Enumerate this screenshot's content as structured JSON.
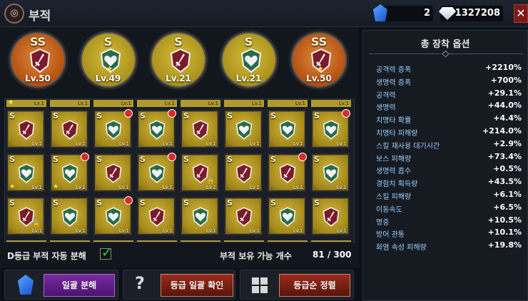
{
  "header": {
    "title": "부적",
    "gem_count": "2",
    "diamond_count": "1327208",
    "close_label": "✕"
  },
  "equipped": [
    {
      "grade": "SS",
      "level": "Lv.50",
      "type": "sword",
      "color": "orange",
      "star": false
    },
    {
      "grade": "S",
      "level": "Lv.49",
      "type": "heart",
      "color": "gold",
      "star": true
    },
    {
      "grade": "S",
      "level": "Lv.21",
      "type": "sword",
      "color": "gold",
      "star": false
    },
    {
      "grade": "S",
      "level": "Lv.21",
      "type": "heart",
      "color": "gold",
      "star": false
    },
    {
      "grade": "SS",
      "level": "Lv.50",
      "type": "sword",
      "color": "orange",
      "star": true
    }
  ],
  "grid": {
    "top_levels": [
      "Lv.1",
      "Lv.1",
      "Lv.1",
      "Lv.1",
      "Lv.1",
      "Lv.1",
      "Lv.1",
      "Lv.1"
    ],
    "rows": [
      [
        {
          "grade": "S",
          "level": "Lv.1",
          "type": "sword",
          "badge": false,
          "star": false,
          "lock": false
        },
        {
          "grade": "S",
          "level": "Lv.1",
          "type": "sword",
          "badge": false,
          "star": false,
          "lock": false
        },
        {
          "grade": "S",
          "level": "Lv.1",
          "type": "heart",
          "badge": true,
          "star": false,
          "lock": false
        },
        {
          "grade": "S",
          "level": "Lv.1",
          "type": "heart",
          "badge": true,
          "star": false,
          "lock": false
        },
        {
          "grade": "S",
          "level": "Lv.1",
          "type": "sword",
          "badge": false,
          "star": false,
          "lock": false
        },
        {
          "grade": "S",
          "level": "Lv.1",
          "type": "heart",
          "badge": false,
          "star": false,
          "lock": false
        },
        {
          "grade": "S",
          "level": "Lv.1",
          "type": "heart",
          "badge": false,
          "star": false,
          "lock": false
        },
        {
          "grade": "S",
          "level": "Lv.1",
          "type": "heart",
          "badge": true,
          "star": false,
          "lock": false
        }
      ],
      [
        {
          "grade": "S",
          "level": "Lv.1",
          "type": "heart",
          "badge": false,
          "star": true,
          "lock": false
        },
        {
          "grade": "S",
          "level": "Lv.1",
          "type": "heart",
          "badge": true,
          "star": true,
          "lock": false
        },
        {
          "grade": "S",
          "level": "Lv.1",
          "type": "sword",
          "badge": false,
          "star": false,
          "lock": false
        },
        {
          "grade": "S",
          "level": "Lv.1",
          "type": "heart",
          "badge": true,
          "star": false,
          "lock": false
        },
        {
          "grade": "S",
          "level": "Lv.1",
          "type": "sword",
          "badge": false,
          "star": false,
          "lock": true
        },
        {
          "grade": "S",
          "level": "Lv.1",
          "type": "sword",
          "badge": false,
          "star": false,
          "lock": false
        },
        {
          "grade": "S",
          "level": "Lv.1",
          "type": "sword",
          "badge": true,
          "star": false,
          "lock": false
        },
        {
          "grade": "S",
          "level": "Lv.1",
          "type": "heart",
          "badge": false,
          "star": false,
          "lock": false
        }
      ],
      [
        {
          "grade": "S",
          "level": "Lv.1",
          "type": "sword",
          "badge": false,
          "star": false,
          "lock": true
        },
        {
          "grade": "S",
          "level": "Lv.1",
          "type": "heart",
          "badge": false,
          "star": false,
          "lock": false
        },
        {
          "grade": "S",
          "level": "Lv.1",
          "type": "heart",
          "badge": true,
          "star": false,
          "lock": false
        },
        {
          "grade": "S",
          "level": "Lv.1",
          "type": "sword",
          "badge": false,
          "star": false,
          "lock": false
        },
        {
          "grade": "S",
          "level": "Lv.1",
          "type": "heart",
          "badge": false,
          "star": false,
          "lock": false
        },
        {
          "grade": "S",
          "level": "Lv.1",
          "type": "sword",
          "badge": false,
          "star": false,
          "lock": false
        },
        {
          "grade": "S",
          "level": "Lv.1",
          "type": "heart",
          "badge": false,
          "star": false,
          "lock": false
        },
        {
          "grade": "S",
          "level": "Lv.1",
          "type": "sword",
          "badge": false,
          "star": false,
          "lock": false
        }
      ]
    ]
  },
  "footer": {
    "auto_dismantle_label": "D등급 부적 자동 분해",
    "auto_dismantle_checked": true,
    "capacity_label": "부적 보유 가능 개수",
    "capacity_value": "81 / 300"
  },
  "buttons": {
    "bulk_dismantle": "일괄 분해",
    "grade_confirm": "등급 일괄 확인",
    "sort_grade": "등급순 정렬",
    "help": "?"
  },
  "options": {
    "title": "총 장착 옵션",
    "stats": [
      {
        "label": "공격력 증폭",
        "value": "+2210%"
      },
      {
        "label": "생명력 증폭",
        "value": "+700%"
      },
      {
        "label": "공격력",
        "value": "+29.1%"
      },
      {
        "label": "생명력",
        "value": "+44.0%"
      },
      {
        "label": "치명타 확률",
        "value": "+4.4%"
      },
      {
        "label": "치명타 피해량",
        "value": "+214.0%"
      },
      {
        "label": "스킬 재사용 대기시간",
        "value": "+2.9%"
      },
      {
        "label": "보스 피해량",
        "value": "+73.4%"
      },
      {
        "label": "생명력 흡수",
        "value": "+0.5%"
      },
      {
        "label": "경험치 획득량",
        "value": "+43.5%"
      },
      {
        "label": "스킬 피해량",
        "value": "+6.1%"
      },
      {
        "label": "이동속도",
        "value": "+6.5%"
      },
      {
        "label": "명중",
        "value": "+10.5%"
      },
      {
        "label": "방어 관통",
        "value": "+10.1%"
      },
      {
        "label": "화염 속성 피해량",
        "value": "+19.8%"
      }
    ]
  },
  "colors": {
    "stat_label": "#9ad0ff",
    "card_gold": "#d2b63a",
    "equip_orange": "#e08a3a",
    "badge_red": "#d82a2a"
  }
}
